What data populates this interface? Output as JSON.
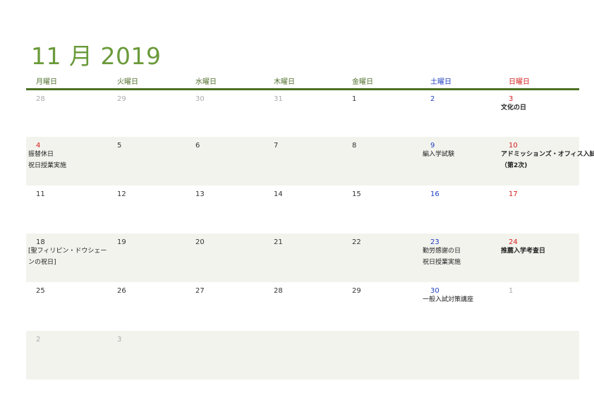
{
  "title": "11 月 2019",
  "weekdays": [
    "月曜日",
    "火曜日",
    "水曜日",
    "木曜日",
    "金曜日",
    "土曜日",
    "日曜日"
  ],
  "weeks": [
    [
      {
        "day": "28",
        "muted": true,
        "events": []
      },
      {
        "day": "29",
        "muted": true,
        "events": []
      },
      {
        "day": "30",
        "muted": true,
        "events": []
      },
      {
        "day": "31",
        "muted": true,
        "events": []
      },
      {
        "day": "1",
        "events": []
      },
      {
        "day": "2",
        "events": []
      },
      {
        "day": "3",
        "events": [
          "文化の日"
        ]
      }
    ],
    [
      {
        "day": "4",
        "red": true,
        "events": [
          "振替休日",
          "祝日授業実施"
        ]
      },
      {
        "day": "5",
        "events": []
      },
      {
        "day": "6",
        "events": []
      },
      {
        "day": "7",
        "events": []
      },
      {
        "day": "8",
        "events": []
      },
      {
        "day": "9",
        "events": [
          "編入学試験"
        ]
      },
      {
        "day": "10",
        "events": [
          "アドミッションズ・オフィス入試",
          "（第2次)"
        ]
      }
    ],
    [
      {
        "day": "11",
        "events": []
      },
      {
        "day": "12",
        "events": []
      },
      {
        "day": "13",
        "events": []
      },
      {
        "day": "14",
        "events": []
      },
      {
        "day": "15",
        "events": []
      },
      {
        "day": "16",
        "events": []
      },
      {
        "day": "17",
        "events": []
      }
    ],
    [
      {
        "day": "18",
        "events": [
          "[聖フィリピン・ドウシェーンの祝日]"
        ]
      },
      {
        "day": "19",
        "events": []
      },
      {
        "day": "20",
        "events": []
      },
      {
        "day": "21",
        "events": []
      },
      {
        "day": "22",
        "events": []
      },
      {
        "day": "23",
        "events": [
          "勤労感謝の日",
          "祝日授業実施"
        ]
      },
      {
        "day": "24",
        "events": [
          "推薦入学考査日"
        ]
      }
    ],
    [
      {
        "day": "25",
        "events": []
      },
      {
        "day": "26",
        "events": []
      },
      {
        "day": "27",
        "events": []
      },
      {
        "day": "28",
        "events": []
      },
      {
        "day": "29",
        "events": []
      },
      {
        "day": "30",
        "events": [
          "一般入試対策講座"
        ]
      },
      {
        "day": "1",
        "muted": true,
        "events": []
      }
    ],
    [
      {
        "day": "2",
        "muted": true,
        "events": []
      },
      {
        "day": "3",
        "muted": true,
        "events": []
      }
    ]
  ],
  "colors": {
    "title": "#6a9a3a",
    "header_rule": "#4d7024",
    "saturday": "#1f3fbf",
    "sunday": "#d42020",
    "shaded_row": "#f3f3ee",
    "muted": "#aaaaaa"
  }
}
